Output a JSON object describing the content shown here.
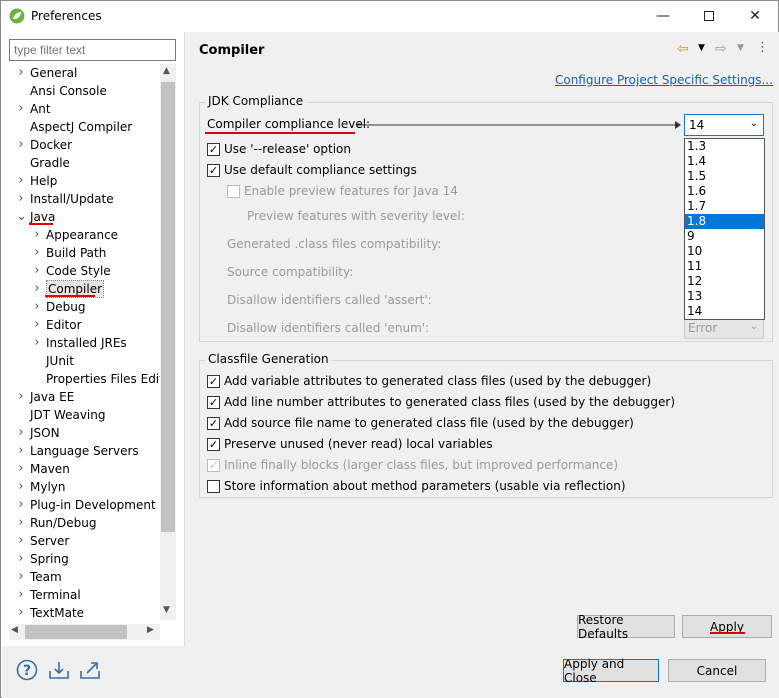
{
  "window": {
    "title": "Preferences",
    "min_icon": "minimize-icon",
    "max_icon": "maximize-icon",
    "close_icon": "close-icon"
  },
  "filter": {
    "placeholder": "type filter text"
  },
  "tree": [
    {
      "label": "General",
      "exp": ">",
      "indent": 0
    },
    {
      "label": "Ansi Console",
      "exp": "",
      "indent": 0
    },
    {
      "label": "Ant",
      "exp": ">",
      "indent": 0
    },
    {
      "label": "AspectJ Compiler",
      "exp": "",
      "indent": 0
    },
    {
      "label": "Docker",
      "exp": ">",
      "indent": 0
    },
    {
      "label": "Gradle",
      "exp": "",
      "indent": 0
    },
    {
      "label": "Help",
      "exp": ">",
      "indent": 0
    },
    {
      "label": "Install/Update",
      "exp": ">",
      "indent": 0
    },
    {
      "label": "Java",
      "exp": "v",
      "indent": 0
    },
    {
      "label": "Appearance",
      "exp": ">",
      "indent": 1
    },
    {
      "label": "Build Path",
      "exp": ">",
      "indent": 1
    },
    {
      "label": "Code Style",
      "exp": ">",
      "indent": 1
    },
    {
      "label": "Compiler",
      "exp": ">",
      "indent": 1
    },
    {
      "label": "Debug",
      "exp": ">",
      "indent": 1
    },
    {
      "label": "Editor",
      "exp": ">",
      "indent": 1
    },
    {
      "label": "Installed JREs",
      "exp": ">",
      "indent": 1
    },
    {
      "label": "JUnit",
      "exp": "",
      "indent": 1
    },
    {
      "label": "Properties Files Edito",
      "exp": "",
      "indent": 1
    },
    {
      "label": "Java EE",
      "exp": ">",
      "indent": 0
    },
    {
      "label": "JDT Weaving",
      "exp": "",
      "indent": 0
    },
    {
      "label": "JSON",
      "exp": ">",
      "indent": 0
    },
    {
      "label": "Language Servers",
      "exp": ">",
      "indent": 0
    },
    {
      "label": "Maven",
      "exp": ">",
      "indent": 0
    },
    {
      "label": "Mylyn",
      "exp": ">",
      "indent": 0
    },
    {
      "label": "Plug-in Development",
      "exp": ">",
      "indent": 0
    },
    {
      "label": "Run/Debug",
      "exp": ">",
      "indent": 0
    },
    {
      "label": "Server",
      "exp": ">",
      "indent": 0
    },
    {
      "label": "Spring",
      "exp": ">",
      "indent": 0
    },
    {
      "label": "Team",
      "exp": ">",
      "indent": 0
    },
    {
      "label": "Terminal",
      "exp": ">",
      "indent": 0
    },
    {
      "label": "TextMate",
      "exp": ">",
      "indent": 0
    }
  ],
  "page": {
    "title": "Compiler",
    "link": "Configure Project Specific Settings...",
    "jdk_group": "JDK Compliance",
    "compliance_label": "Compiler compliance level:",
    "compliance_value": "14",
    "use_release": "Use '--release' option",
    "use_default": "Use default compliance settings",
    "enable_preview": "Enable preview features for Java 14",
    "preview_severity": "Preview features with severity level:",
    "generated_class": "Generated .class files compatibility:",
    "source_compat": "Source compatibility:",
    "disallow_assert": "Disallow identifiers called 'assert':",
    "disallow_enum": "Disallow identifiers called 'enum':",
    "enum_value": "Error",
    "dropdown_options": [
      "1.3",
      "1.4",
      "1.5",
      "1.6",
      "1.7",
      "1.8",
      "9",
      "10",
      "11",
      "12",
      "13",
      "14"
    ],
    "dropdown_selected": "1.8",
    "classfile_group": "Classfile Generation",
    "cf1": "Add variable attributes to generated class files (used by the debugger)",
    "cf2": "Add line number attributes to generated class files (used by the debugger)",
    "cf3": "Add source file name to generated class file (used by the debugger)",
    "cf4": "Preserve unused (never read) local variables",
    "cf5": "Inline finally blocks (larger class files, but improved performance)",
    "cf6": "Store information about method parameters (usable via reflection)"
  },
  "buttons": {
    "restore": "Restore Defaults",
    "apply": "Apply",
    "apply_close": "Apply and Close",
    "cancel": "Cancel"
  },
  "bottom_icons": [
    "help-icon",
    "import-icon",
    "export-icon"
  ]
}
